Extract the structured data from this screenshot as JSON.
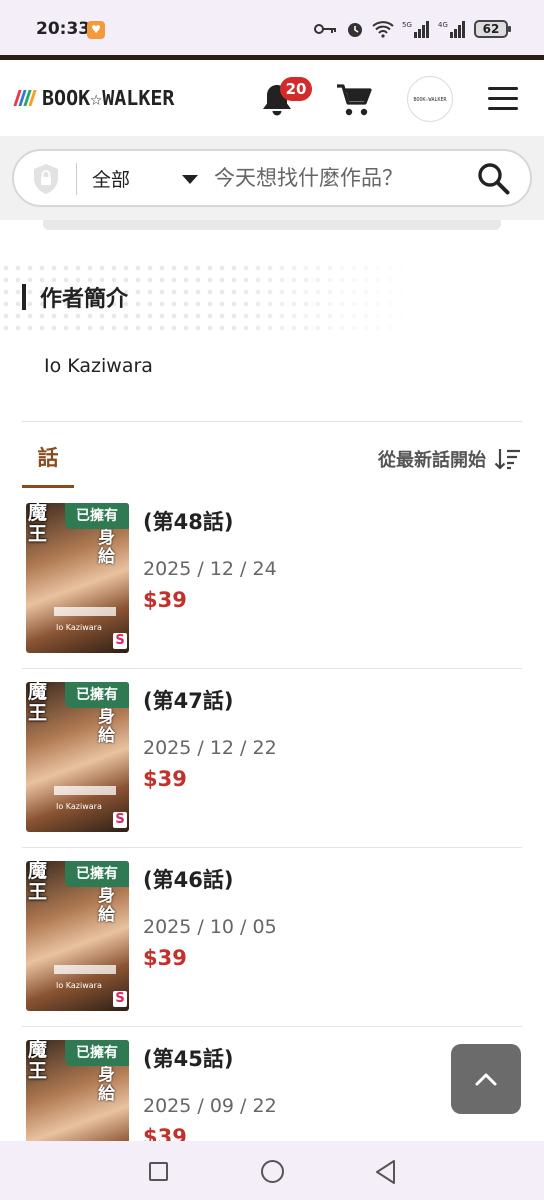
{
  "status_bar": {
    "time": "20:33",
    "battery": "62"
  },
  "header": {
    "logo_text": "BOOK☆WALKER",
    "notification_count": "20",
    "avatar_text": "BOOK☆WALKER"
  },
  "search": {
    "scope": "全部",
    "placeholder": "今天想找什麼作品？"
  },
  "author_section": {
    "title": "作者簡介",
    "author_name": "Io Kaziwara"
  },
  "tabs": {
    "active_tab": "話",
    "sort_label": "從最新話開始"
  },
  "cover": {
    "title_chars": "魔王",
    "subtitle_chars": "身給",
    "author": "Io Kaziwara",
    "label": "S"
  },
  "episodes": [
    {
      "badge": "已擁有",
      "title": "(第48話)",
      "date": "2025 / 12 / 24",
      "price": "$39"
    },
    {
      "badge": "已擁有",
      "title": "(第47話)",
      "date": "2025 / 12 / 22",
      "price": "$39"
    },
    {
      "badge": "已擁有",
      "title": "(第46話)",
      "date": "2025 / 10 / 05",
      "price": "$39"
    },
    {
      "badge": "已擁有",
      "title": "(第45話)",
      "date": "2025 / 09 / 22",
      "price": "$39"
    }
  ],
  "colors": {
    "brand_brown": "#8a4a1f",
    "owned_green": "#2f7a52",
    "price_red": "#c2312b",
    "badge_red": "#d32a2a"
  }
}
